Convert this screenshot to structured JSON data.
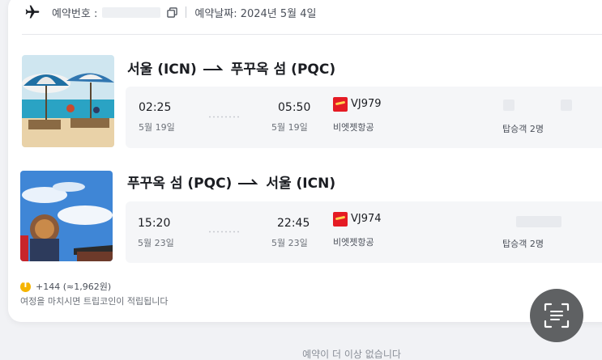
{
  "booking": {
    "number_label": "예약번호 : ",
    "date_label": "예약날짜: 2024년 5월 4일"
  },
  "segments": [
    {
      "route_from": "서울 (ICN)",
      "route_to": "푸꾸옥 섬 (PQC)",
      "depart_time": "02:25",
      "depart_date": "5월 19일",
      "arrive_time": "05:50",
      "arrive_date": "5월 19일",
      "flight_no": "VJ979",
      "airline": "비엣젯항공",
      "passengers": "탑승객 2명"
    },
    {
      "route_from": "푸꾸옥 섬 (PQC)",
      "route_to": "서울 (ICN)",
      "depart_time": "15:20",
      "depart_date": "5월 23일",
      "arrive_time": "22:45",
      "arrive_date": "5월 23일",
      "flight_no": "VJ974",
      "airline": "비엣젯항공",
      "passengers": "탑승객 2명"
    }
  ],
  "reward": {
    "amount": "+144 (≈1,962원)",
    "note": "여정을 마치시면 트립코인이 적립됩니다"
  },
  "footer": {
    "text": "예약이 더 이상 없습니다"
  },
  "icons": {
    "plane": "airplane-icon",
    "copy": "copy-icon",
    "scan": "scan-document-icon",
    "coin": "trip-coin-icon"
  },
  "colors": {
    "accent_red": "#e51b24",
    "coin_gold": "#f5b400"
  }
}
